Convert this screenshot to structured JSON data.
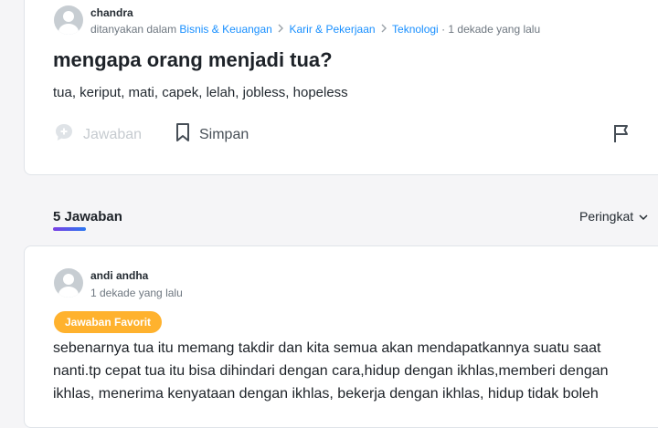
{
  "question": {
    "author": "chandra",
    "asked_prefix": "ditanyakan dalam",
    "categories": [
      "Bisnis & Keuangan",
      "Karir & Pekerjaan",
      "Teknologi"
    ],
    "time_ago": "· 1 dekade yang lalu",
    "title": "mengapa orang menjadi tua?",
    "detail": "tua, keriput, mati, capek, lelah, jobless, hopeless",
    "answer_label": "Jawaban",
    "save_label": "Simpan"
  },
  "answers_header": {
    "count_label": "5 Jawaban",
    "sort_label": "Peringkat"
  },
  "answer": {
    "author": "andi andha",
    "time_ago": "1 dekade yang lalu",
    "badge": "Jawaban Favorit",
    "line1": "sebenarnya tua itu memang takdir dan kita semua akan mendapatkannya suatu saat",
    "line2": "nanti.tp cepat tua itu bisa dihindari dengan cara,hidup dengan ikhlas,memberi dengan",
    "line3": "ikhlas, menerima kenyataan dengan ikhlas, bekerja dengan ikhlas, hidup tidak boleh"
  },
  "colors": {
    "link": "#188fff",
    "badge": "#ffb22e",
    "tab_gradient": [
      "#7b3fe4",
      "#2b78f0"
    ]
  }
}
